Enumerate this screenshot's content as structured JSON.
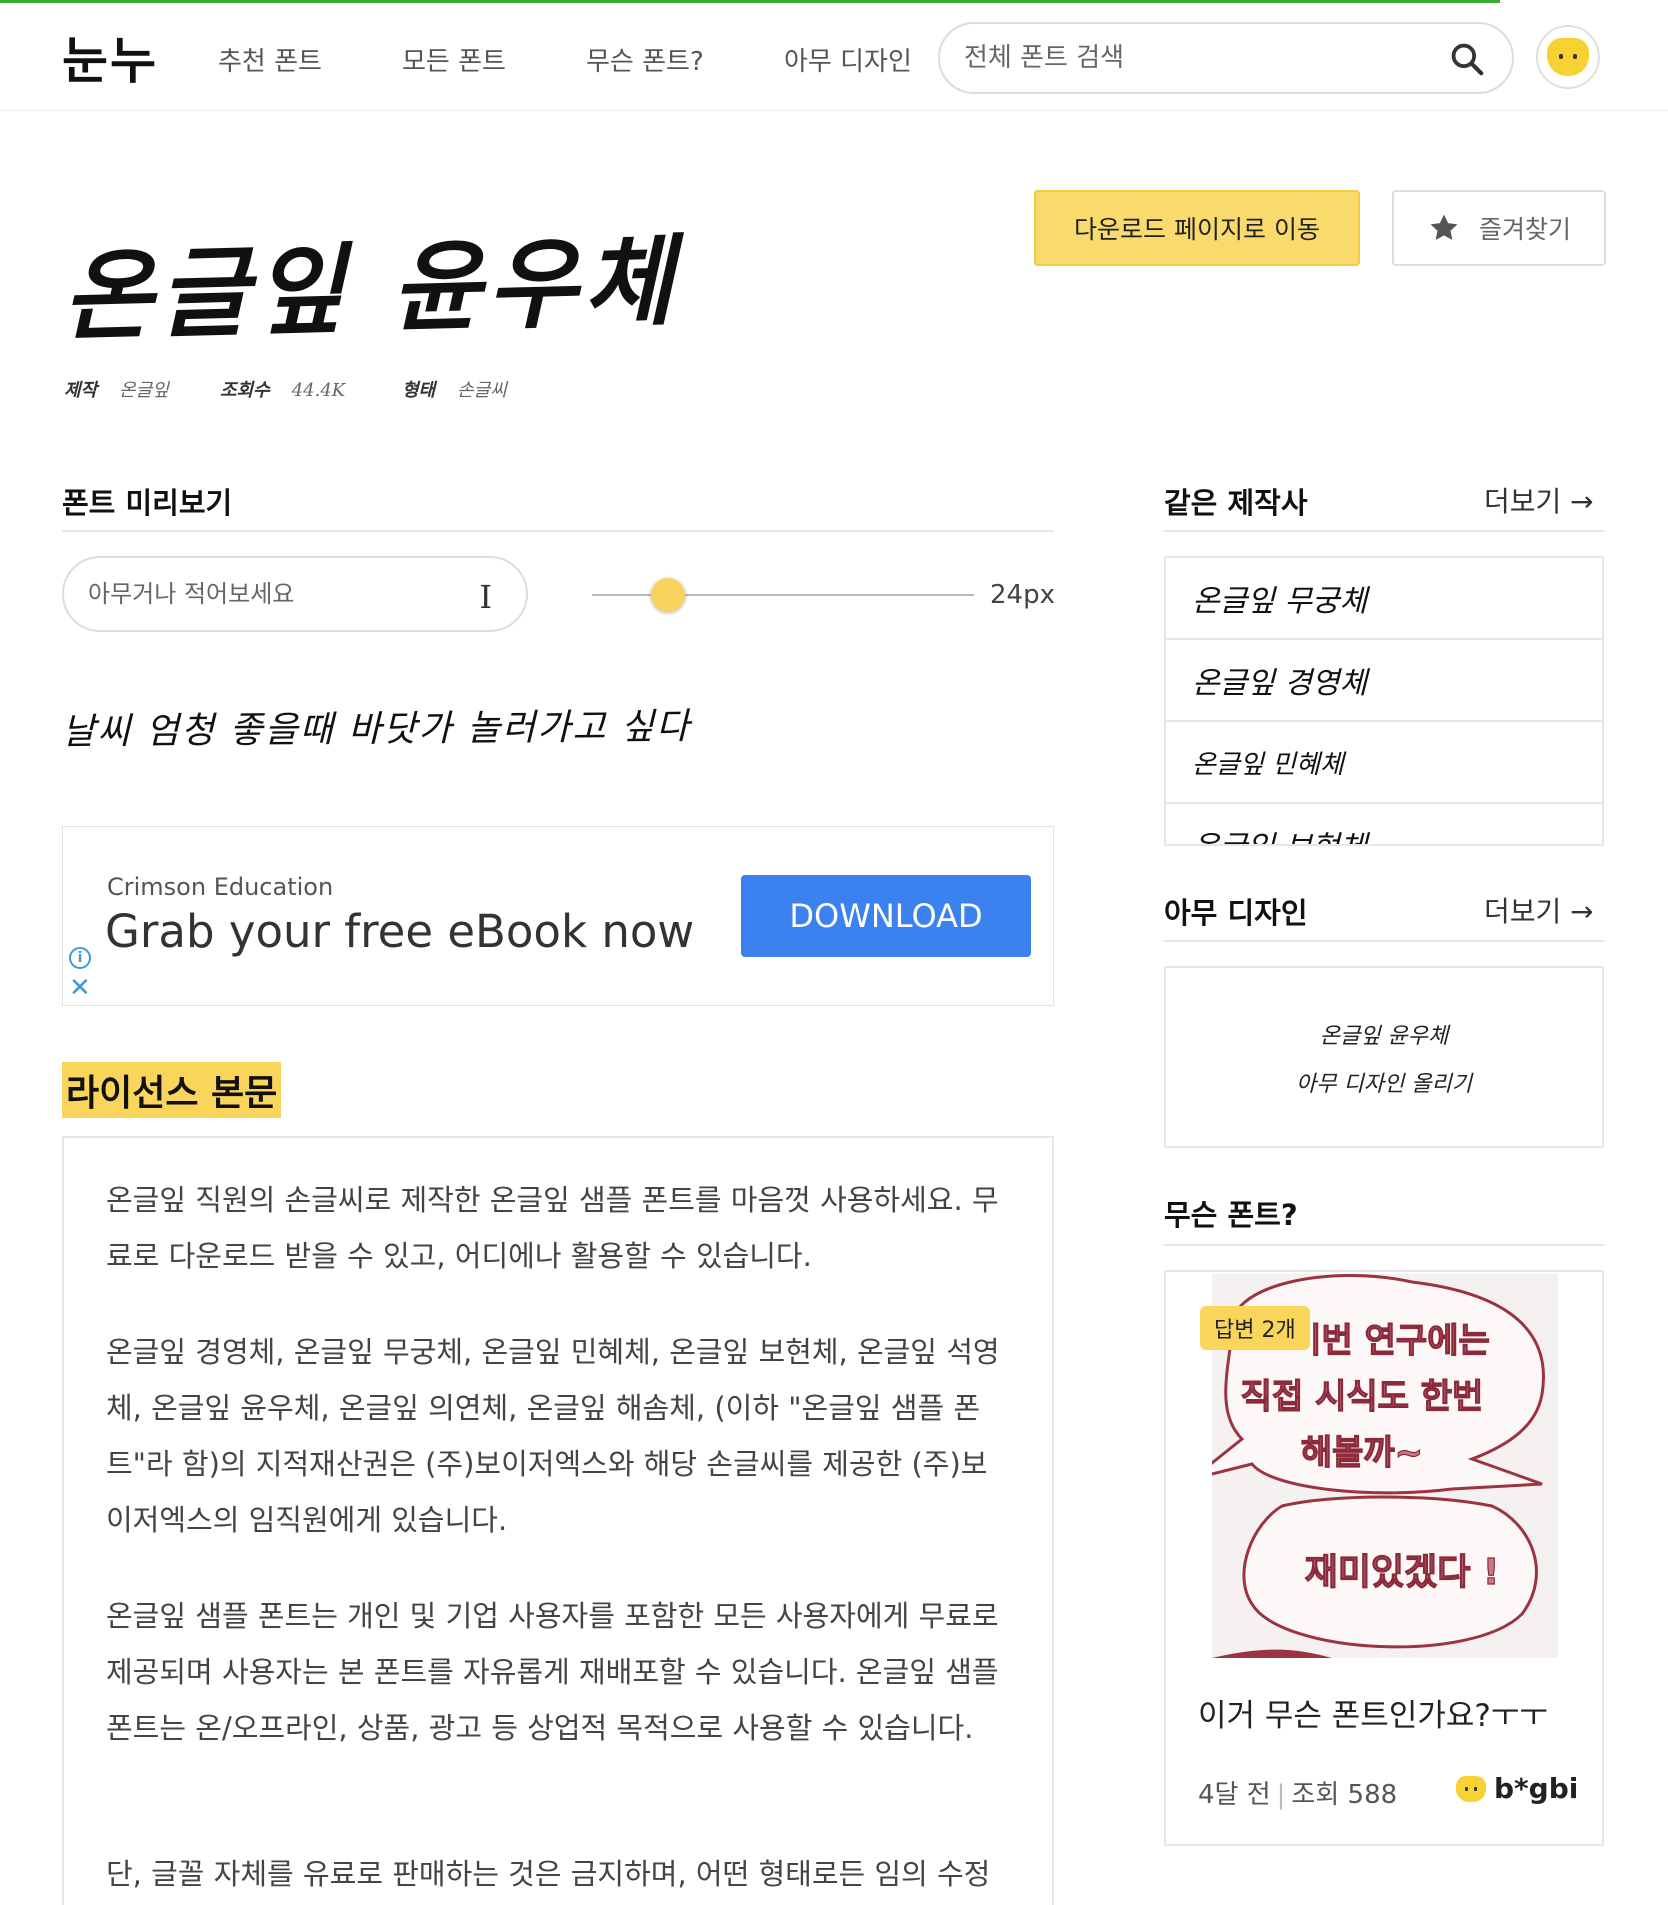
{
  "header": {
    "logo": "눈누",
    "nav": [
      "추천 폰트",
      "모든 폰트",
      "무슨 폰트?",
      "아무 디자인"
    ],
    "search_placeholder": "전체 폰트 검색"
  },
  "font": {
    "name": "온글잎 윤우체",
    "meta": [
      {
        "label": "제작",
        "value": "온글잎"
      },
      {
        "label": "조회수",
        "value": "44.4K"
      },
      {
        "label": "형태",
        "value": "손글씨"
      }
    ],
    "download_label": "다운로드 페이지로 이동",
    "favorite_label": "즐겨찾기"
  },
  "preview": {
    "heading": "폰트 미리보기",
    "input_placeholder": "아무거나 적어보세요",
    "size_label": "24px",
    "size_fraction": 0.2,
    "sample_text": "날씨 엄청 좋을때 바닷가 놀러가고 싶다"
  },
  "ad": {
    "brand": "Crimson Education",
    "title": "Grab your free eBook now",
    "button": "DOWNLOAD"
  },
  "license": {
    "heading": "라이선스 본문",
    "paragraphs": [
      "온글잎 직원의 손글씨로 제작한 온글잎 샘플 폰트를 마음껏 사용하세요. 무료로 다운로드 받을 수 있고, 어디에나 활용할 수 있습니다.",
      "온글잎 경영체, 온글잎 무궁체, 온글잎 민혜체, 온글잎 보현체, 온글잎 석영체, 온글잎 윤우체, 온글잎 의연체, 온글잎 해솜체, (이하 \"온글잎 샘플 폰트\"라 함)의 지적재산권은 (주)보이저엑스와 해당 손글씨를 제공한 (주)보이저엑스의 임직원에게 있습니다.",
      "온글잎 샘플 폰트는 개인 및 기업 사용자를 포함한 모든 사용자에게 무료로 제공되며 사용자는 본 폰트를 자유롭게 재배포할 수 있습니다. 온글잎 샘플 폰트는 온/오프라인, 상품, 광고 등 상업적 목적으로 사용할 수 있습니다.",
      "단, 글꼴 자체를 유료로 판매하는 것은 금지하며, 어떤 형태로든 임의 수정"
    ]
  },
  "sidebar": {
    "same_maker": {
      "heading": "같은 제작사",
      "more": "더보기 →",
      "items": [
        "온글잎 무궁체",
        "온글잎 경영체",
        "온글잎 민혜체",
        "온글잎 보현체"
      ]
    },
    "design": {
      "heading": "아무 디자인",
      "more": "더보기 →",
      "card_line1": "온글잎 윤우체",
      "card_line2": "아무 디자인 올리기"
    },
    "question": {
      "heading": "무슨 폰트?",
      "badge": "답변 2개",
      "image_text": [
        "이번 연구에는",
        "직접 시식도 한번",
        "해볼까~",
        "재미있겠다 !"
      ],
      "title": "이거 무슨 폰트인가요?ㅜㅜ",
      "time": "4달 전",
      "views": "조회 588",
      "user": "b*gbi"
    }
  }
}
